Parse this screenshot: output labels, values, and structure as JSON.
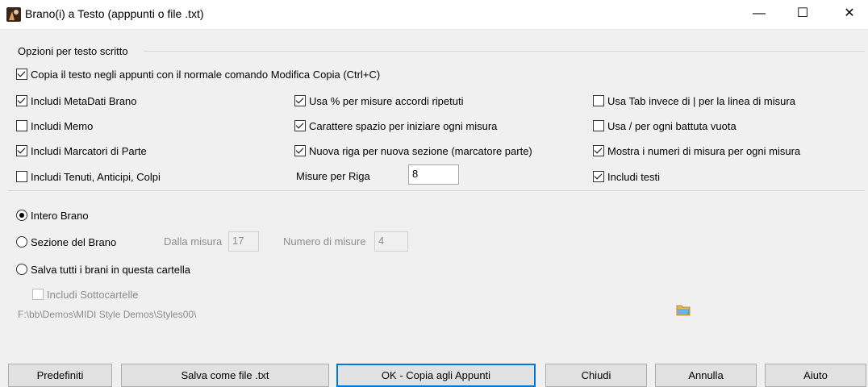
{
  "window": {
    "title": "Brano(i) a Testo (apppunti o file .txt)",
    "minimize": "—",
    "maximize": "☐",
    "close": "✕"
  },
  "options": {
    "group_label": "Opzioni per testo scritto",
    "copy_clipboard": {
      "label": "Copia il testo negli appunti con il normale comando Modifica Copia (Ctrl+C)",
      "checked": true
    },
    "col1": [
      {
        "label": "Includi MetaDati Brano",
        "checked": true
      },
      {
        "label": "Includi Memo",
        "checked": false
      },
      {
        "label": "Includi Marcatori di Parte",
        "checked": true
      },
      {
        "label": "Includi Tenuti, Anticipi, Colpi",
        "checked": false
      }
    ],
    "col2": [
      {
        "label": "Usa % per misure accordi ripetuti",
        "checked": true
      },
      {
        "label": "Carattere spazio per iniziare ogni misura",
        "checked": true
      },
      {
        "label": "Nuova riga per nuova sezione (marcatore parte)",
        "checked": true
      }
    ],
    "bars_per_row_label": "Misure per Riga",
    "bars_per_row_value": "8",
    "col3": [
      {
        "label": "Usa Tab invece di | per la linea di misura",
        "checked": false
      },
      {
        "label": "Usa / per ogni battuta vuota",
        "checked": false
      },
      {
        "label": "Mostra i numeri di misura per ogni misura",
        "checked": true
      },
      {
        "label": "Includi testi",
        "checked": true
      }
    ]
  },
  "range": {
    "whole_song": {
      "label": "Intero Brano",
      "selected": true
    },
    "section": {
      "label": "Sezione del Brano",
      "selected": false
    },
    "from_bar_label": "Dalla misura",
    "from_bar_value": "17",
    "num_bars_label": "Numero di misure",
    "num_bars_value": "4",
    "save_all": {
      "label": "Salva tutti i brani in questa cartella",
      "selected": false
    },
    "include_subfolders": {
      "label": "Includi Sottocartelle",
      "checked": false
    },
    "folder_path": "F:\\bb\\Demos\\MIDI Style Demos\\Styles00\\"
  },
  "buttons": {
    "defaults": "Predefiniti",
    "save_txt": "Salva come file .txt",
    "ok_copy": "OK - Copia agli Appunti",
    "close": "Chiudi",
    "cancel": "Annulla",
    "help": "Aiuto"
  },
  "colors": {
    "accent": "#0078d7",
    "background": "#f0f0f0"
  },
  "icons": {
    "app": "app-icon",
    "folder": "folder-browse-icon"
  }
}
